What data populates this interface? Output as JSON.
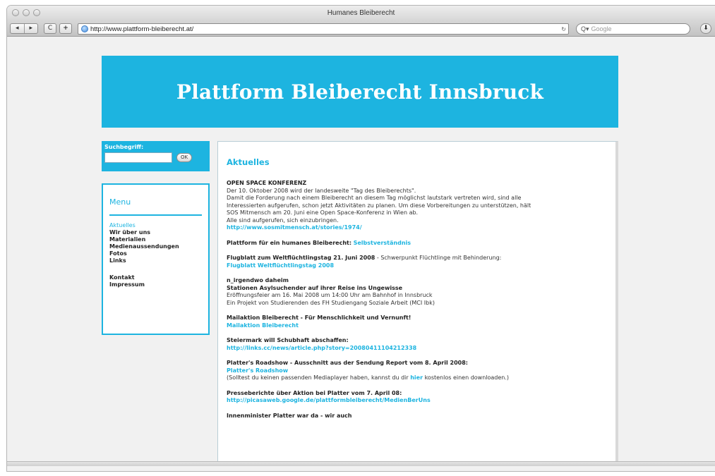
{
  "window": {
    "title": "Humanes Bleiberecht"
  },
  "toolbar": {
    "back_label": "◂",
    "forward_label": "▸",
    "reload_label": "C",
    "add_label": "+",
    "url": "http://www.plattform-bleiberecht.at/",
    "search_placeholder": "Google",
    "bookmark_label": "⬇"
  },
  "page": {
    "banner_title": "Plattform Bleiberecht Innsbruck",
    "search": {
      "label": "Suchbegriff:",
      "value": "",
      "button": "OK"
    },
    "menu": {
      "title": "Menu",
      "items": [
        "Aktuelles",
        "Wir über uns",
        "Materialien",
        "Medienaussendungen",
        "Fotos",
        "Links"
      ],
      "items2": [
        "Kontakt",
        "Impressum"
      ]
    },
    "content": {
      "heading": "Aktuelles",
      "news": [
        {
          "title": "OPEN SPACE KONFERENZ",
          "lines": [
            "Der 10. Oktober 2008 wird der landesweite \"Tag des Bleiberechts\".",
            "Damit die Forderung nach einem Bleiberecht an diesem Tag möglichst lautstark vertreten wird, sind alle",
            "Interessierten aufgerufen, schon jetzt Aktivitäten zu planen. Um diese Vorbereitungen zu unterstützen, hält",
            "SOS Mitmensch am 20. Juni eine Open Space-Konferenz in Wien ab.",
            "Alle sind aufgerufen, sich einzubringen."
          ],
          "link": "http://www.sosmitmensch.at/stories/1974/"
        },
        {
          "title": "Plattform für ein humanes Bleiberecht:",
          "inline_link": "Selbstverständnis"
        },
        {
          "title": "Flugblatt zum Weltflüchtlingstag 21. Juni 2008",
          "suffix": " - Schwerpunkt Flüchtlinge mit Behinderung:",
          "link": "Flugblatt Weltflüchtlingstag 2008"
        },
        {
          "title": "n_irgendwo daheim",
          "title2": "Stationen Asylsuchender auf ihrer Reise ins Ungewisse",
          "lines": [
            "Eröffnungsfeier am 16. Mai 2008 um 14:00 Uhr am Bahnhof in Innsbruck",
            "Ein Projekt von Studierenden des FH Studiengang Soziale Arbeit (MCI Ibk)"
          ]
        },
        {
          "title": "Mailaktion Bleiberecht - Für Menschlichkeit und Vernunft!",
          "link": "Mailaktion Bleiberecht"
        },
        {
          "title": "Steiermark will Schubhaft abschaffen:",
          "link": "http://links.cc/news/article.php?story=20080411104212338"
        },
        {
          "title": "Platter's Roadshow - Ausschnitt aus der Sendung Report vom 8. April 2008:",
          "link": "Platter's Roadshow",
          "note_before": "(Solltest du keinen passenden Mediaplayer haben, kannst du dir ",
          "note_link": "hier",
          "note_after": " kostenlos einen downloaden.)"
        },
        {
          "title": "Presseberichte über Aktion bei Platter vom 7. April 08:",
          "link": "http://picasaweb.google.de/plattformbleiberecht/MedienBerUns"
        },
        {
          "title": "Innenminister Platter war da - wir auch"
        }
      ]
    }
  }
}
